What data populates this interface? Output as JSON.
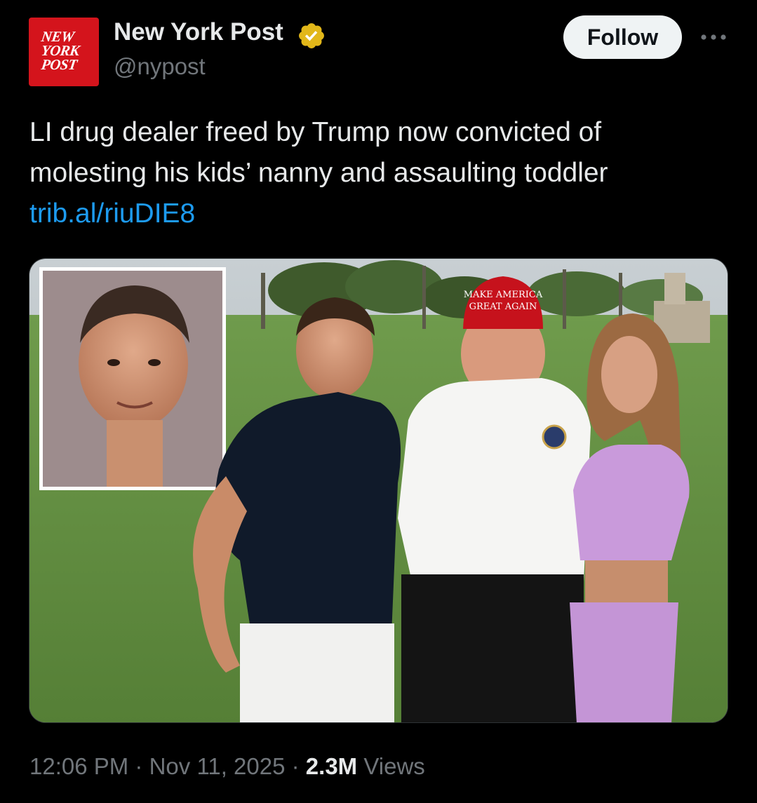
{
  "account": {
    "avatar_logo_lines": [
      "NEW",
      "YORK",
      "POST"
    ],
    "display_name": "New York Post",
    "handle": "@nypost",
    "verified_badge_color": "#e2b719"
  },
  "actions": {
    "follow_label": "Follow",
    "more_icon": "more-horizontal-icon"
  },
  "tweet": {
    "text_line_1": "LI drug dealer freed by Trump now convicted of",
    "text_line_2": "molesting his kids’ nanny and assaulting toddler",
    "link": "trib.al/riuDIE8"
  },
  "media": {
    "cap_text_line_1": "MAKE AMERICA",
    "cap_text_line_2": "GREAT AGAIN"
  },
  "meta": {
    "time": "12:06 PM",
    "date": "Nov 11, 2025",
    "separator": "·",
    "views_count": "2.3M",
    "views_label": "Views"
  },
  "colors": {
    "background": "#000000",
    "text": "#e7e9ea",
    "secondary": "#71767b",
    "link": "#1d9bf0",
    "brand_red": "#d4141c"
  }
}
